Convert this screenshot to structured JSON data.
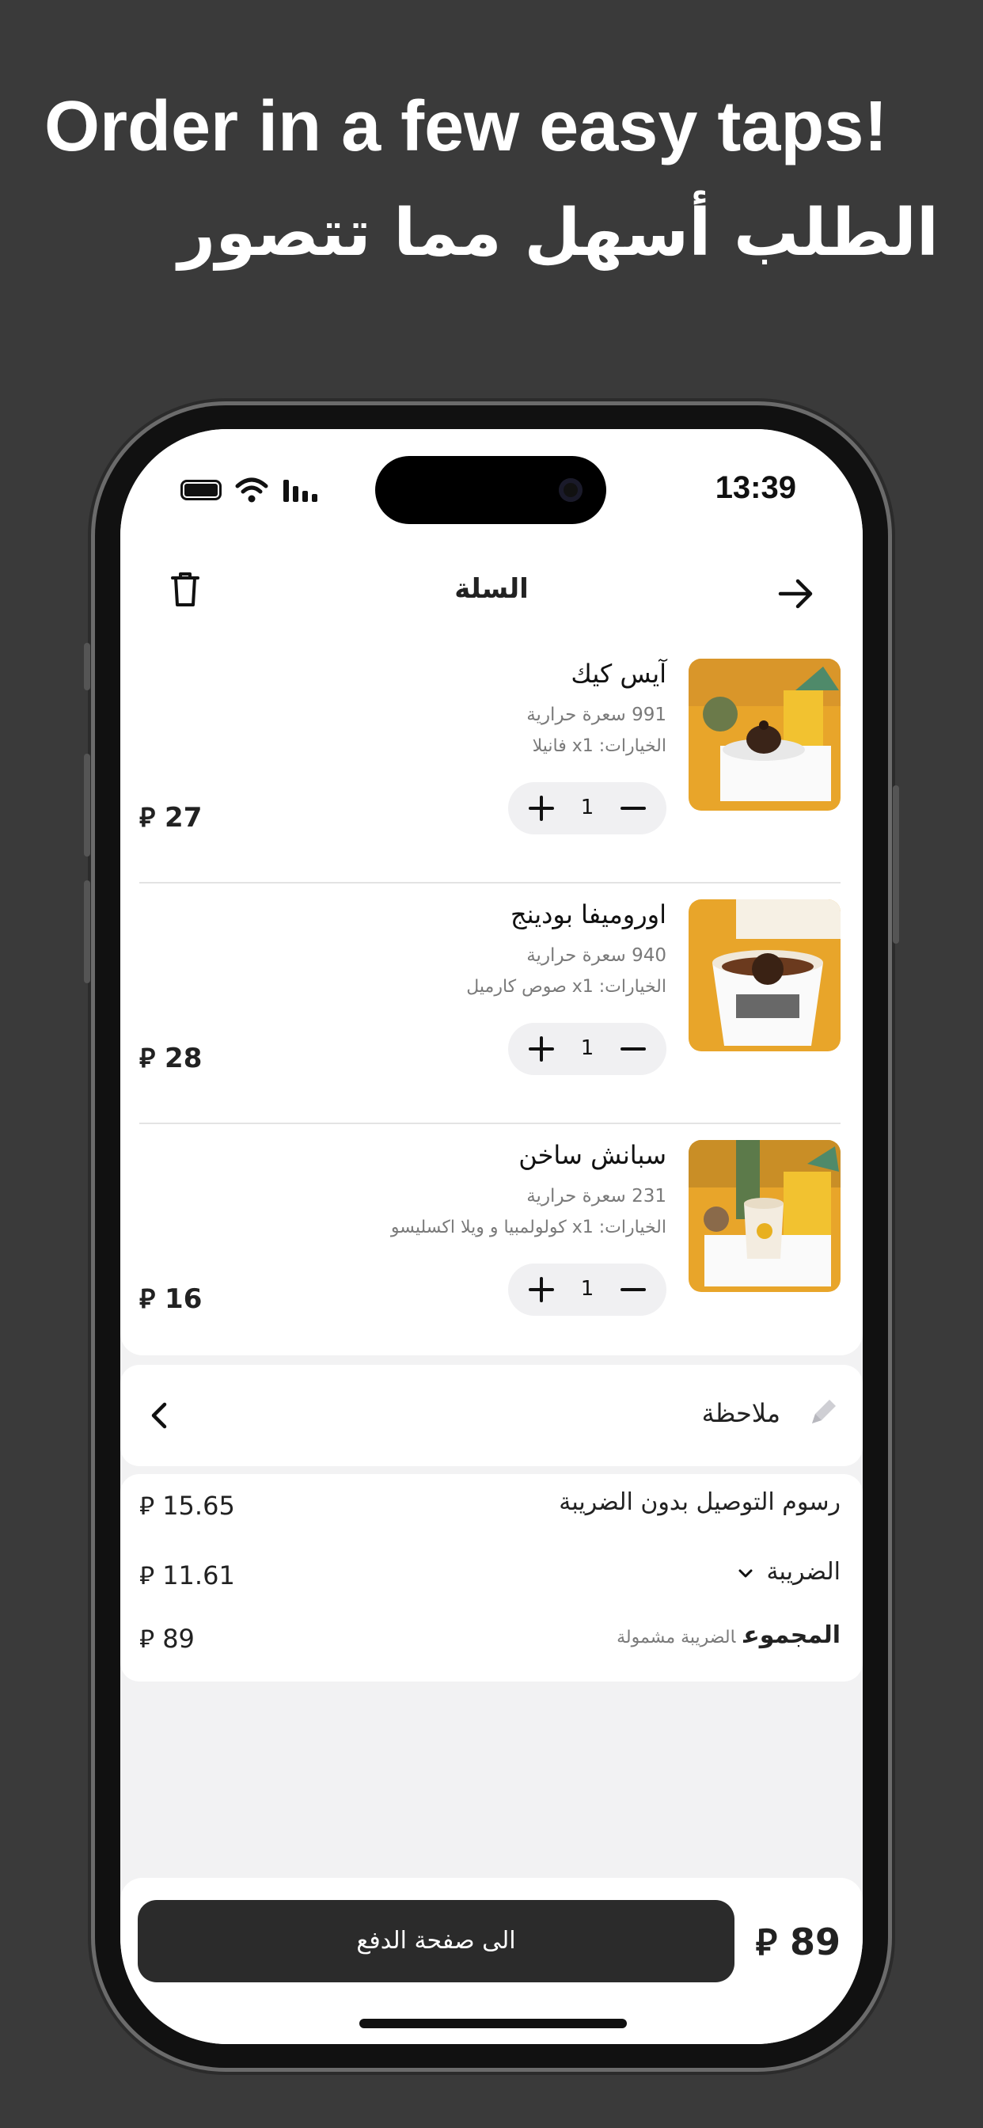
{
  "headline": {
    "english": "Order in a few easy taps!",
    "arabic": "الطلب أسهل مما تتصور"
  },
  "status_bar": {
    "time": "13:39"
  },
  "header": {
    "title": "السلة"
  },
  "currency_symbol": "⃁",
  "items": [
    {
      "name": "آيس كيك",
      "calories": "991 سعرة حرارية",
      "options": "الخيارات: x1 فانيلا",
      "quantity": "1",
      "price": "27",
      "image": "cake-on-plate"
    },
    {
      "name": "اوروميفا بودينج",
      "calories": "940 سعرة حرارية",
      "options": "الخيارات: x1 صوص  كارميل",
      "quantity": "1",
      "price": "28",
      "image": "pudding-cup"
    },
    {
      "name": "سبانش ساخن",
      "calories": "231 سعرة حرارية",
      "options": "الخيارات: x1 كولولمبيا و ويلا اكسليسو",
      "quantity": "1",
      "price": "16",
      "image": "hot-latte-cup"
    }
  ],
  "note": {
    "label": "ملاحظة"
  },
  "summary": {
    "delivery_label": "رسوم التوصيل بدون الضريبة",
    "delivery_value": "15.65",
    "tax_label": "الضريبة",
    "tax_value": "11.61",
    "total_label": "المجموع",
    "total_sub": "الضريبة مشمولة",
    "total_value": "89"
  },
  "bottom_bar": {
    "checkout_label": "الى صفحة الدفع",
    "total": "89"
  },
  "colors": {
    "background": "#3a3a3a",
    "button": "#2b2b2b",
    "image_bg": "#e8a52a"
  }
}
